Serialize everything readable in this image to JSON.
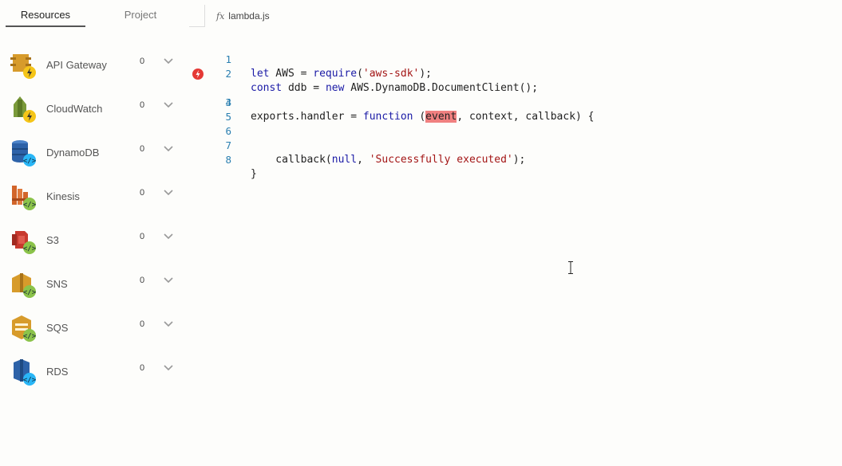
{
  "sidebar": {
    "tabs": [
      {
        "label": "Resources"
      },
      {
        "label": "Project"
      }
    ],
    "resources": [
      {
        "label": "API Gateway",
        "count": "0",
        "icon": "api-gateway-icon",
        "badge": "lightning-badge",
        "color": "#d79b2b"
      },
      {
        "label": "CloudWatch",
        "count": "0",
        "icon": "cloudwatch-icon",
        "badge": "lightning-badge",
        "color": "#7a9a3a"
      },
      {
        "label": "DynamoDB",
        "count": "0",
        "icon": "dynamodb-icon",
        "badge": "code-badge",
        "color": "#2d62a8"
      },
      {
        "label": "Kinesis",
        "count": "0",
        "icon": "kinesis-icon",
        "badge": "code-badge",
        "color": "#d2652a"
      },
      {
        "label": "S3",
        "count": "0",
        "icon": "s3-icon",
        "badge": "code-badge",
        "color": "#c8392e"
      },
      {
        "label": "SNS",
        "count": "0",
        "icon": "sns-icon",
        "badge": "code-badge",
        "color": "#d79b2b"
      },
      {
        "label": "SQS",
        "count": "0",
        "icon": "sqs-icon",
        "badge": "code-badge",
        "color": "#d79b2b"
      },
      {
        "label": "RDS",
        "count": "0",
        "icon": "rds-icon",
        "badge": "code-badge",
        "color": "#2d62a8"
      }
    ]
  },
  "editor": {
    "tab": {
      "icon": "fx",
      "label": "lambda.js"
    },
    "lines": [
      "1",
      "2",
      "3",
      "4",
      "5",
      "6",
      "7",
      "8"
    ]
  },
  "colors": {
    "lightning_badge": "#f5c518",
    "code_badge": "#29b6f6",
    "error": "#e53935",
    "highlight": "#f08080"
  }
}
